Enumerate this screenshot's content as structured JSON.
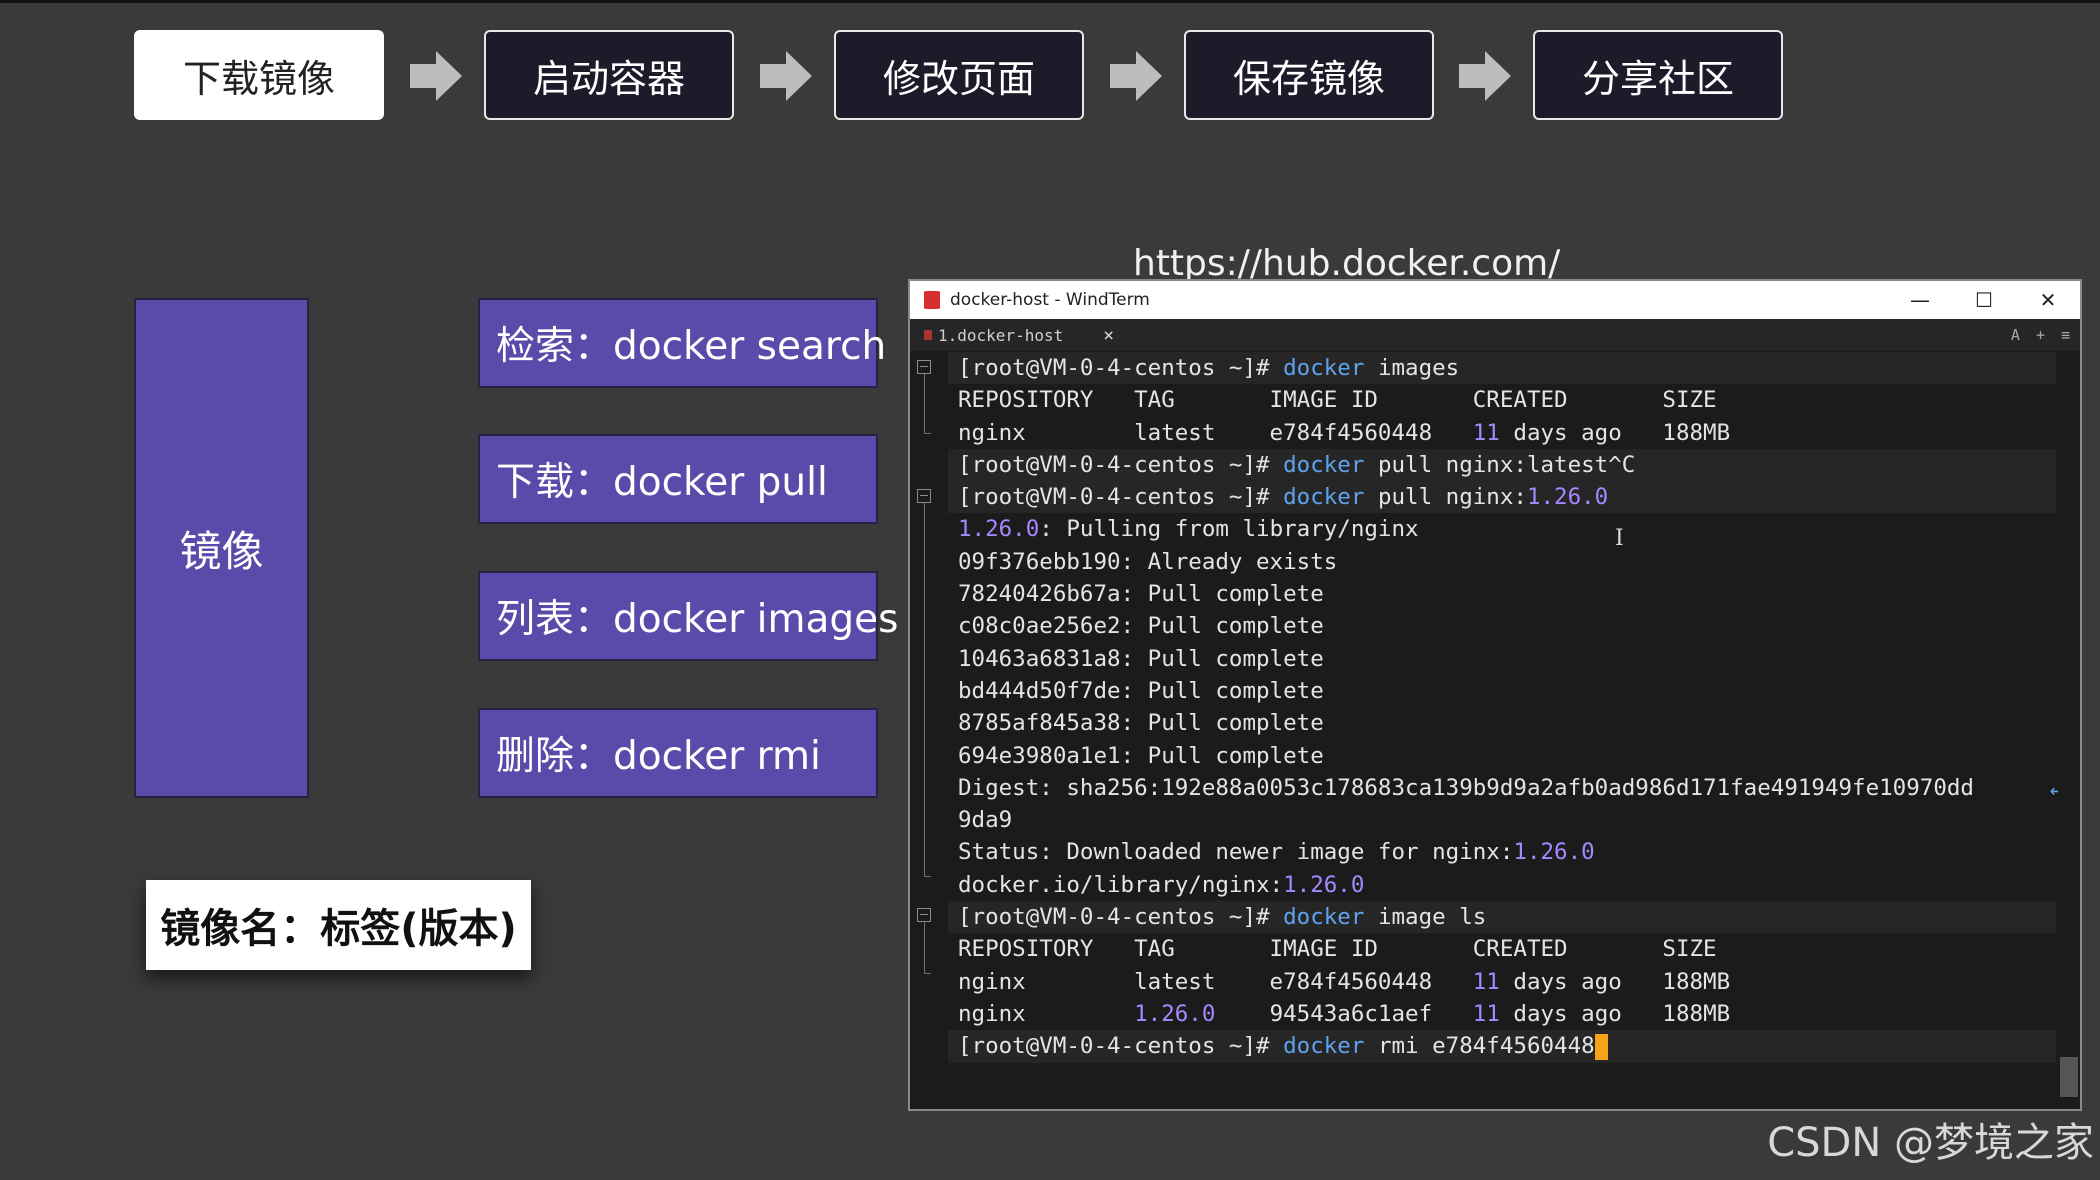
{
  "flow": {
    "steps": [
      {
        "label": "下载镜像"
      },
      {
        "label": "启动容器"
      },
      {
        "label": "修改页面"
      },
      {
        "label": "保存镜像"
      },
      {
        "label": "分享社区"
      }
    ]
  },
  "concept": {
    "main_label": "镜像",
    "commands": [
      {
        "label": "检索：docker search"
      },
      {
        "label": "下载：docker pull"
      },
      {
        "label": "列表：docker images"
      },
      {
        "label": "删除：docker rmi"
      }
    ],
    "name_format": "镜像名：标签(版本)"
  },
  "hub_url": "https://hub.docker.com/",
  "window": {
    "title": "docker-host - WindTerm",
    "tab_label": "1.docker-host",
    "tab_tools": [
      "A",
      "+",
      "≡"
    ],
    "controls": {
      "minimize": "—",
      "maximize": "☐",
      "close": "✕"
    }
  },
  "terminal": {
    "prompt": "[root@VM-0-4-centos ~]#",
    "lines": [
      {
        "prompt": "[root@VM-0-4-centos ~]#",
        "cmd": "docker",
        "rest": "images",
        "hl": true
      },
      {
        "text": "REPOSITORY   TAG       IMAGE ID       CREATED       SIZE"
      },
      {
        "text": "nginx        latest    e784f4560448   ",
        "num": "11",
        "text2": " days ago   188MB"
      },
      {
        "prompt": "[root@VM-0-4-centos ~]#",
        "cmd": "docker",
        "rest": "pull nginx:latest^C",
        "hl": true
      },
      {
        "prompt": "[root@VM-0-4-centos ~]#",
        "cmd": "docker",
        "rest": "pull nginx:",
        "num_after": "1.26.0",
        "hl": true
      },
      {
        "num": "1.26.0",
        "text2": ": Pulling from library/nginx"
      },
      {
        "text": "09f376ebb190: Already exists"
      },
      {
        "text": "78240426b67a: Pull complete"
      },
      {
        "text": "c08c0ae256e2: Pull complete"
      },
      {
        "text": "10463a6831a8: Pull complete"
      },
      {
        "text": "bd444d50f7de: Pull complete"
      },
      {
        "text": "8785af845a38: Pull complete"
      },
      {
        "text": "694e3980a1e1: Pull complete"
      },
      {
        "text": "Digest: sha256:192e88a0053c178683ca139b9d9a2afb0ad986d171fae491949fe10970dd",
        "wrap": true
      },
      {
        "text": "9da9"
      },
      {
        "text": "Status: Downloaded newer image for nginx:",
        "num": "1.26.0"
      },
      {
        "text": "docker.io/library/nginx:",
        "num": "1.26.0"
      },
      {
        "prompt": "[root@VM-0-4-centos ~]#",
        "cmd": "docker",
        "rest": "image ls",
        "hl": true
      },
      {
        "text": "REPOSITORY   TAG       IMAGE ID       CREATED       SIZE"
      },
      {
        "text": "nginx        latest    e784f4560448   ",
        "num": "11",
        "text2": " days ago   188MB"
      },
      {
        "text": "nginx        ",
        "num": "1.26.0",
        "text2": "    94543a6c1aef   ",
        "num2": "11",
        "text3": " days ago   188MB"
      },
      {
        "prompt": "[root@VM-0-4-centos ~]#",
        "cmd": "docker",
        "rest": "rmi e784f4560448",
        "hl": true,
        "cursor": true
      }
    ]
  },
  "watermark": "CSDN @梦境之家"
}
